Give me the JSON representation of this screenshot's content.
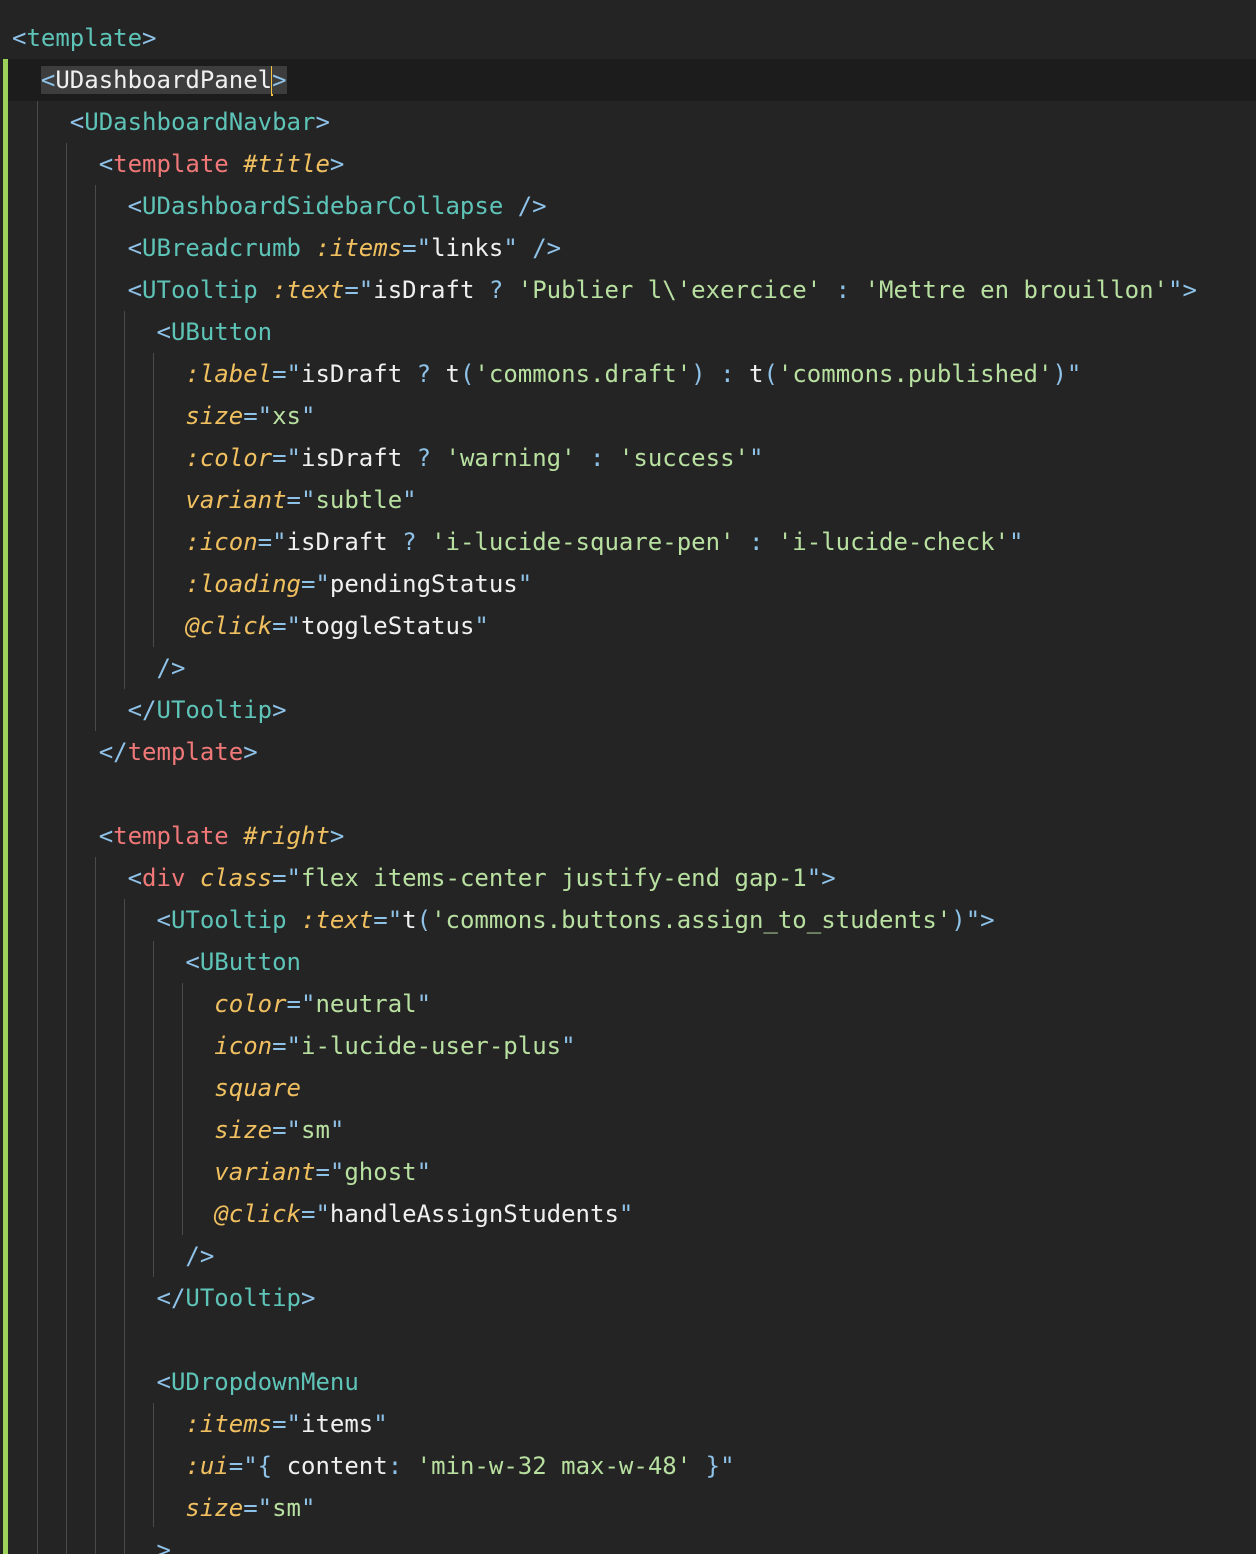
{
  "editor": {
    "theme_colors": {
      "background": "#242424",
      "punctuation": "#8fc2e8",
      "component_tag": "#5ec4b8",
      "template_tag": "#f07878",
      "attribute": "#f0c060",
      "string": "#b8e0a0",
      "modified_bar": "#9cd15a",
      "cursor": "#f5c542"
    },
    "code": {
      "l01": {
        "open": "<",
        "tag": "template",
        "close": ">"
      },
      "l02": {
        "open": "<",
        "tag": "UDashboardPanel",
        "tag_end": "l",
        "close": ">"
      },
      "l03": {
        "open": "<",
        "tag": "UDashboardNavbar",
        "close": ">"
      },
      "l04": {
        "open": "<",
        "tag": "template",
        "slot": "#title",
        "close": ">"
      },
      "l05": {
        "open": "<",
        "tag": "UDashboardSidebarCollapse",
        "close": " />"
      },
      "l06": {
        "open": "<",
        "tag": "UBreadcrumb",
        "attr": ":items",
        "eq": "=\"",
        "expr": "links",
        "q": "\"",
        "close": " />"
      },
      "l07": {
        "open": "<",
        "tag": "UTooltip",
        "attr": ":text",
        "eq": "=\"",
        "v1": "isDraft",
        "op1": " ? ",
        "s1": "'Publier l\\'exercice'",
        "op2": " : ",
        "s2": "'Mettre en brouillon'",
        "q": "\"",
        "close": ">"
      },
      "l08": {
        "open": "<",
        "tag": "UButton"
      },
      "l09": {
        "attr": ":label",
        "eq": "=\"",
        "v1": "isDraft",
        "op1": " ? ",
        "f1": "t",
        "p1": "(",
        "s1": "'commons.draft'",
        "p2": ")",
        "op2": " : ",
        "f2": "t",
        "p3": "(",
        "s2": "'commons.published'",
        "p4": ")",
        "q": "\""
      },
      "l10": {
        "attr": "size",
        "eq": "=\"",
        "val": "xs",
        "q": "\""
      },
      "l11": {
        "attr": ":color",
        "eq": "=\"",
        "v1": "isDraft",
        "op1": " ? ",
        "s1": "'warning'",
        "op2": " : ",
        "s2": "'success'",
        "q": "\""
      },
      "l12": {
        "attr": "variant",
        "eq": "=\"",
        "val": "subtle",
        "q": "\""
      },
      "l13": {
        "attr": ":icon",
        "eq": "=\"",
        "v1": "isDraft",
        "op1": " ? ",
        "s1": "'i-lucide-square-pen'",
        "op2": " : ",
        "s2": "'i-lucide-check'",
        "q": "\""
      },
      "l14": {
        "attr": ":loading",
        "eq": "=\"",
        "expr": "pendingStatus",
        "q": "\""
      },
      "l15": {
        "attr": "@click",
        "eq": "=\"",
        "expr": "toggleStatus",
        "q": "\""
      },
      "l16": {
        "close": "/>"
      },
      "l17": {
        "open": "</",
        "tag": "UTooltip",
        "close": ">"
      },
      "l18": {
        "open": "</",
        "tag": "template",
        "close": ">"
      },
      "l20": {
        "open": "<",
        "tag": "template",
        "slot": "#right",
        "close": ">"
      },
      "l21": {
        "open": "<",
        "tag": "div",
        "attr": "class",
        "eq": "=\"",
        "val": "flex items-center justify-end gap-1",
        "q": "\"",
        "close": ">"
      },
      "l22": {
        "open": "<",
        "tag": "UTooltip",
        "attr": ":text",
        "eq": "=\"",
        "f1": "t",
        "p1": "(",
        "s1": "'commons.buttons.assign_to_students'",
        "p2": ")",
        "q": "\"",
        "close": ">"
      },
      "l23": {
        "open": "<",
        "tag": "UButton"
      },
      "l24": {
        "attr": "color",
        "eq": "=\"",
        "val": "neutral",
        "q": "\""
      },
      "l25": {
        "attr": "icon",
        "eq": "=\"",
        "val": "i-lucide-user-plus",
        "q": "\""
      },
      "l26": {
        "attr": "square"
      },
      "l27": {
        "attr": "size",
        "eq": "=\"",
        "val": "sm",
        "q": "\""
      },
      "l28": {
        "attr": "variant",
        "eq": "=\"",
        "val": "ghost",
        "q": "\""
      },
      "l29": {
        "attr": "@click",
        "eq": "=\"",
        "expr": "handleAssignStudents",
        "q": "\""
      },
      "l30": {
        "close": "/>"
      },
      "l31": {
        "open": "</",
        "tag": "UTooltip",
        "close": ">"
      },
      "l33": {
        "open": "<",
        "tag": "UDropdownMenu"
      },
      "l34": {
        "attr": ":items",
        "eq": "=\"",
        "expr": "items",
        "q": "\""
      },
      "l35": {
        "attr": ":ui",
        "eq": "=\"",
        "b1": "{ ",
        "key": "content",
        "colon": ": ",
        "s1": "'min-w-32 max-w-48'",
        "b2": " }",
        "q": "\""
      },
      "l36": {
        "attr": "size",
        "eq": "=\"",
        "val": "sm",
        "q": "\""
      },
      "l37": {
        "close": ">"
      }
    }
  }
}
